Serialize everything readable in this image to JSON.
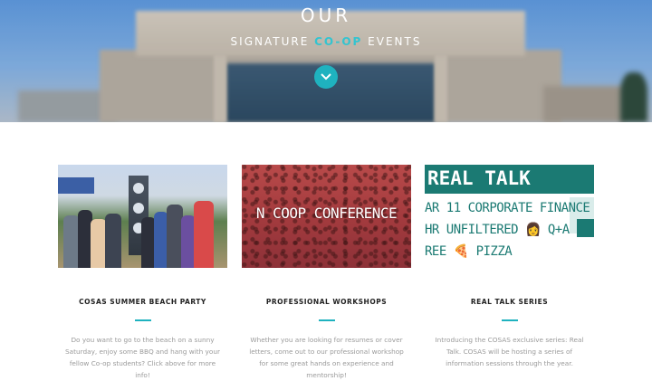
{
  "hero": {
    "title": "OUR",
    "subtitle_pre": "SIGNATURE",
    "subtitle_accent": "CO-OP",
    "subtitle_post": "EVENTS",
    "scroll_icon": "chevron-down-icon",
    "accent_color": "#1fb2bf"
  },
  "events": [
    {
      "title": "COSAS SUMMER BEACH PARTY",
      "description": "Do you want to go to the beach on a sunny Saturday, enjoy some BBQ and hang with your fellow Co-op students? Click above for more info!"
    },
    {
      "title": "PROFESSIONAL WORKSHOPS",
      "image_text": "N COOP CONFERENCE",
      "description": "Whether you are looking for resumes or cover letters, come out to our professional workshop for some great hands on experience and mentorship!"
    },
    {
      "title": "REAL TALK SERIES",
      "image_heading": "REAL TALK",
      "image_lines": [
        "AR 11 CORPORATE FINANCE",
        "HR UNFILTERED 👩 Q+A",
        "REE 🍕 PIZZA"
      ],
      "description": "Introducing the COSAS exclusive series: Real Talk. COSAS will be hosting a series of information sessions through the year."
    }
  ]
}
